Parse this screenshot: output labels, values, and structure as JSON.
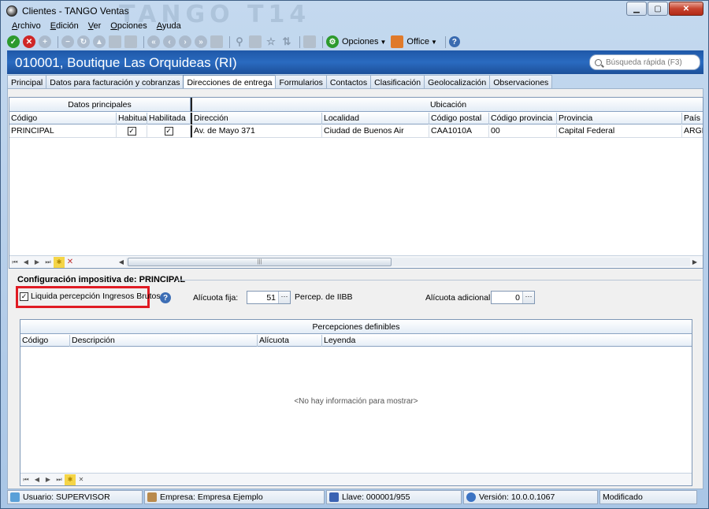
{
  "window": {
    "title": "Clientes - TANGO Ventas",
    "watermark": "TANGO T14",
    "buttons": {
      "minimize": "▁",
      "maximize": "▢",
      "close": "✕"
    }
  },
  "menu": [
    "Archivo",
    "Edición",
    "Ver",
    "Opciones",
    "Ayuda"
  ],
  "toolbar": {
    "opciones_label": "Opciones",
    "office_label": "Office",
    "help_glyph": "?"
  },
  "record": {
    "title": "010001, Boutique Las Orquideas (RI)"
  },
  "search": {
    "placeholder": "Búsqueda rápida (F3)"
  },
  "tabs": [
    {
      "label": "Principal"
    },
    {
      "label": "Datos para facturación y cobranzas"
    },
    {
      "label": "Direcciones de entrega"
    },
    {
      "label": "Formularios"
    },
    {
      "label": "Contactos"
    },
    {
      "label": "Clasificación"
    },
    {
      "label": "Geolocalización"
    },
    {
      "label": "Observaciones"
    }
  ],
  "addresses_grid": {
    "band_principal": "Datos principales",
    "band_ubicacion": "Ubicación",
    "columns": [
      "Código",
      "Habitual",
      "Habilitada",
      "Dirección",
      "Localidad",
      "Código postal",
      "Código provincia",
      "Provincia",
      "País"
    ],
    "rows": [
      {
        "codigo": "PRINCIPAL",
        "habitual": true,
        "habilitada": true,
        "direccion": "Av. de Mayo 371",
        "localidad": "Ciudad de Buenos Air",
        "codigo_postal": "CAA1010A",
        "codigo_provincia": "00",
        "provincia": "Capital Federal",
        "pais": "ARGEN"
      }
    ]
  },
  "config": {
    "title": "Configuración impositiva de: PRINCIPAL",
    "liquida_label": "Liquida percepción Ingresos Brutos",
    "liquida_checked": true,
    "alicuota_fija_label": "Alícuota fija:",
    "alicuota_fija_value": "51",
    "percep_label": "Percep. de IIBB",
    "alicuota_adicional_label": "Alícuota adicional:",
    "alicuota_adicional_value": "0"
  },
  "perceptions_grid": {
    "band": "Percepciones definibles",
    "columns": [
      "Código",
      "Descripción",
      "Alícuota",
      "Leyenda"
    ],
    "empty_message": "<No hay información para mostrar>"
  },
  "statusbar": {
    "usuario": "Usuario: SUPERVISOR",
    "empresa": "Empresa: Empresa Ejemplo",
    "llave": "Llave: 000001/955",
    "version": "Versión: 10.0.0.1067",
    "estado": "Modificado"
  },
  "colors": {
    "header_band": "#2a6bc0",
    "highlight": "#e01b24",
    "ok": "#2d9a2d",
    "cancel": "#cf2626"
  }
}
